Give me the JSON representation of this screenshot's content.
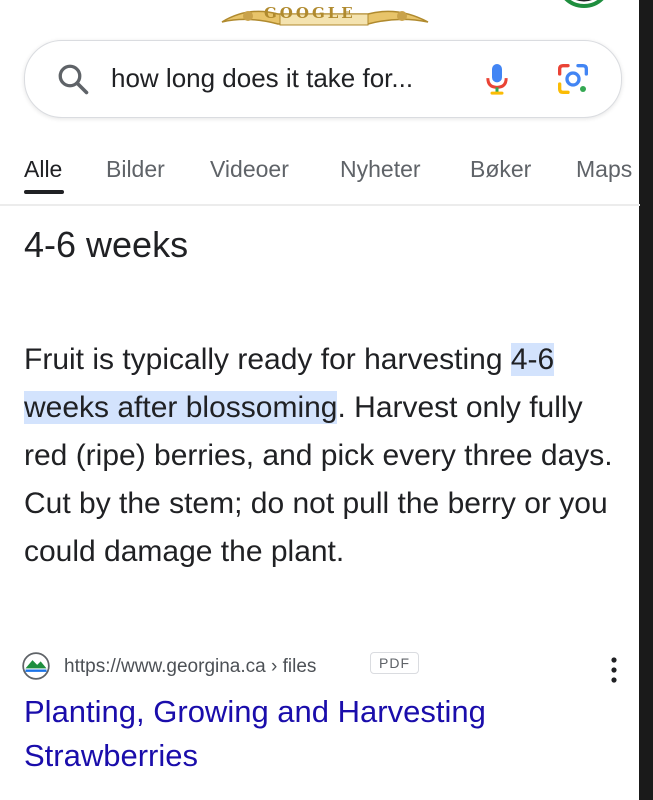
{
  "doodle": {
    "text": "GOOGLE"
  },
  "search": {
    "query": "how long does it take for..."
  },
  "tabs": [
    {
      "label": "Alle"
    },
    {
      "label": "Bilder"
    },
    {
      "label": "Videoer"
    },
    {
      "label": "Nyheter"
    },
    {
      "label": "Bøker"
    },
    {
      "label": "Maps"
    }
  ],
  "answer": {
    "title": "4-6 weeks",
    "snippet_before": "Fruit is typically ready for harvesting ",
    "snippet_highlight": "4-6 weeks after blossoming",
    "snippet_after": ". Harvest only fully red (ripe) berries, and pick every three days. Cut by the stem; do not pull the berry or you could damage the plant."
  },
  "source": {
    "url": "https://www.georgina.ca › files",
    "badge": "PDF",
    "title": "Planting, Growing and Harvesting Strawberries"
  },
  "colors": {
    "link": "#1a0dab",
    "highlight": "#d3e3fd",
    "google_blue": "#4285F4",
    "google_red": "#EA4335",
    "google_yellow": "#FBBC05",
    "google_green": "#34A853"
  }
}
